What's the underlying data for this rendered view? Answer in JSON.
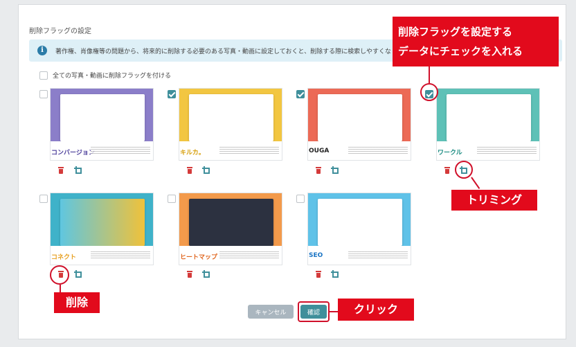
{
  "section_title": "削除フラッグの設定",
  "info_text": "著作権、肖像権等の問題から、将来的に削除する必要のある写真・動画に設定しておくと、削除する際に検索しやすくな",
  "check_all_label": "全ての写真・動画に削除フラッグを付ける",
  "cards": [
    {
      "checked": false,
      "logo": "コンバージョン",
      "color": "#8b7ec9"
    },
    {
      "checked": true,
      "logo": "キルカ。",
      "color": "#f2c641"
    },
    {
      "checked": true,
      "logo": "OUGA",
      "color": "#ec6a56"
    },
    {
      "checked": true,
      "logo": "ワークル",
      "color": "#5ec1b7"
    },
    {
      "checked": false,
      "logo": "コネクト",
      "color": "#3fb2c9"
    },
    {
      "checked": false,
      "logo": "ヒートマップ",
      "color": "#f39a4b"
    },
    {
      "checked": false,
      "logo": "SEO",
      "color": "#5fc2e8"
    }
  ],
  "buttons": {
    "cancel": "キャンセル",
    "confirm": "確認"
  },
  "annotations": {
    "flag_line1": "削除フラッグを設定する",
    "flag_line2": "データにチェックを入れる",
    "trim": "トリミング",
    "delete": "削除",
    "click": "クリック"
  },
  "colors": {
    "accent": "#3f8f9b",
    "annotation_red": "#e20a1c",
    "danger": "#d43a3a"
  }
}
